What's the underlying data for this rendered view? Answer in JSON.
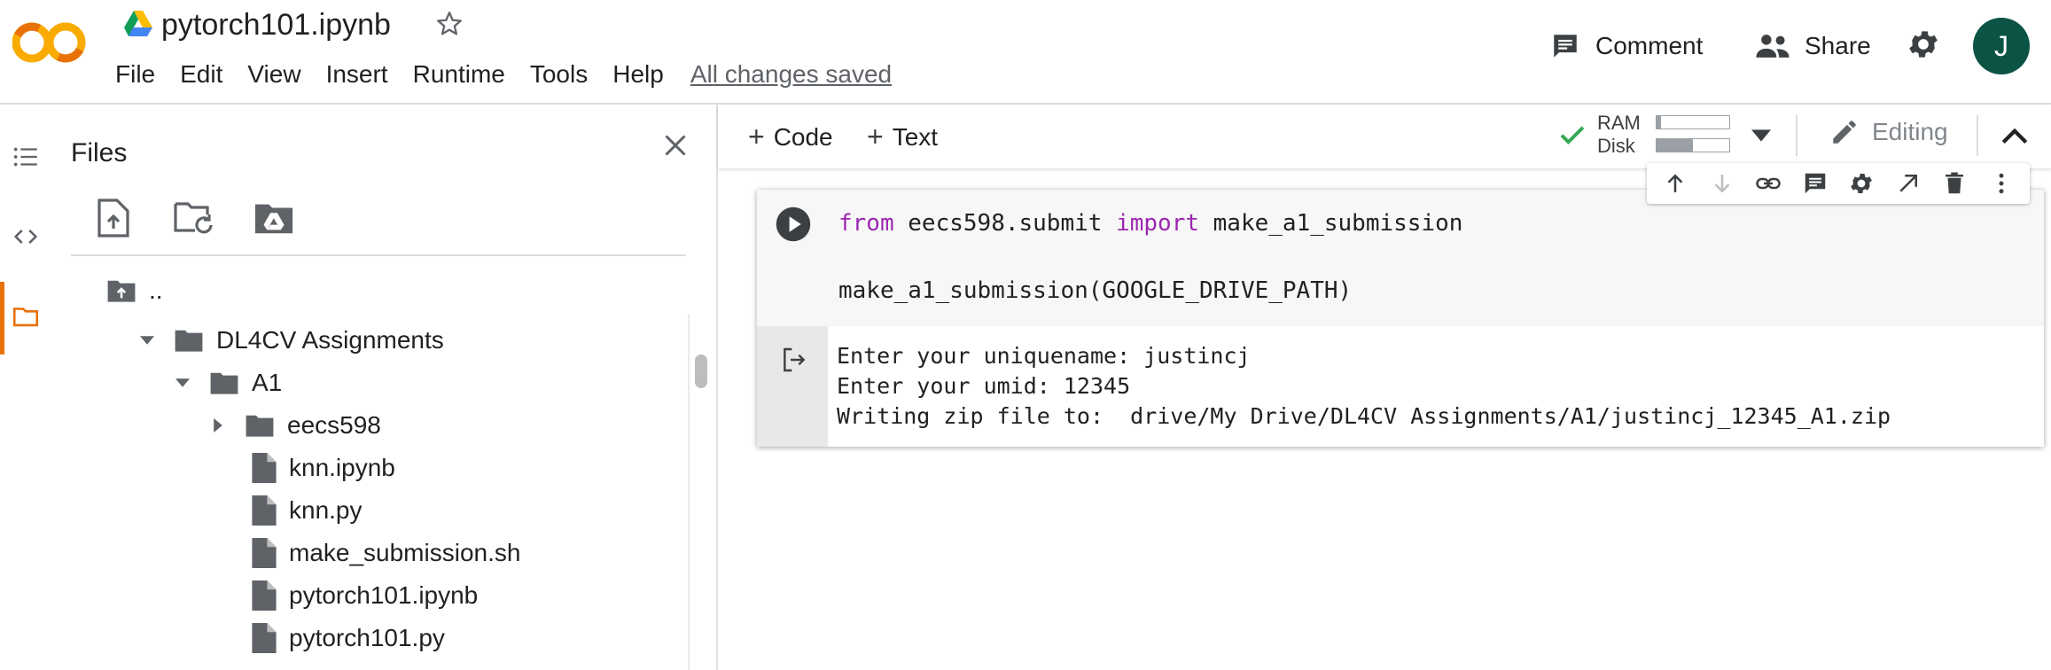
{
  "header": {
    "title": "pytorch101.ipynb",
    "menu": [
      "File",
      "Edit",
      "View",
      "Insert",
      "Runtime",
      "Tools",
      "Help"
    ],
    "save_status": "All changes saved",
    "comment_label": "Comment",
    "share_label": "Share",
    "avatar_initial": "J"
  },
  "files": {
    "title": "Files",
    "tree": [
      {
        "label": "..",
        "type": "parent"
      },
      {
        "label": "DL4CV Assignments",
        "type": "folder-open"
      },
      {
        "label": "A1",
        "type": "folder-open"
      },
      {
        "label": "eecs598",
        "type": "folder-closed"
      },
      {
        "label": "knn.ipynb",
        "type": "file"
      },
      {
        "label": "knn.py",
        "type": "file"
      },
      {
        "label": "make_submission.sh",
        "type": "file"
      },
      {
        "label": "pytorch101.ipynb",
        "type": "file"
      },
      {
        "label": "pytorch101.py",
        "type": "file"
      }
    ]
  },
  "toolbar": {
    "add_code": "Code",
    "add_text": "Text",
    "ram_label": "RAM",
    "disk_label": "Disk",
    "ram_usage": 0.06,
    "disk_usage": 0.5,
    "editing_label": "Editing"
  },
  "cell": {
    "code": {
      "kw_from": "from",
      "module": " eecs598.submit ",
      "kw_import": "import",
      "name": " make_a1_submission",
      "line2": "make_a1_submission(GOOGLE_DRIVE_PATH)"
    },
    "output": [
      "Enter your uniquename: justincj",
      "Enter your umid: 12345",
      "Writing zip file to:  drive/My Drive/DL4CV Assignments/A1/justincj_12345_A1.zip"
    ]
  },
  "colors": {
    "accent": "#e8710a",
    "avatar": "#0b5345",
    "keyword": "#9c27b0",
    "check": "#34a853"
  }
}
